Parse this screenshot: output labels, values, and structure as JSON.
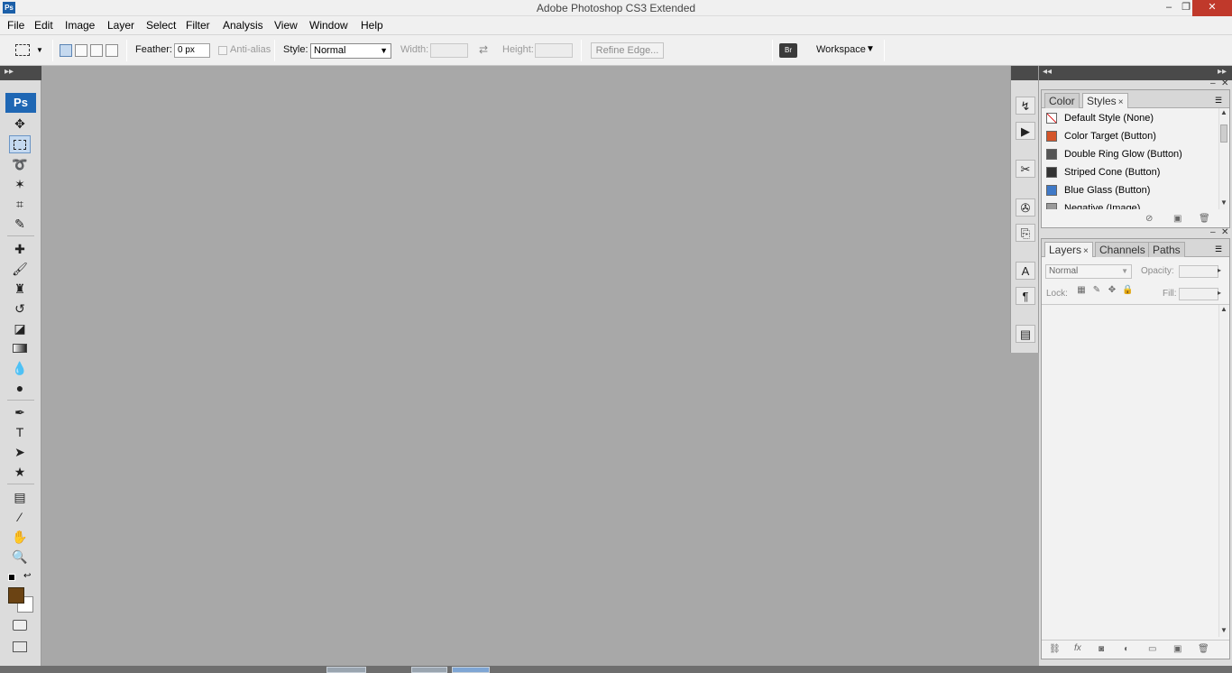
{
  "app": {
    "logo": "Ps",
    "title": "Adobe Photoshop CS3 Extended",
    "window_controls": {
      "minimize": "–",
      "restore": "❐",
      "close": "✕"
    }
  },
  "menubar": {
    "items": [
      "File",
      "Edit",
      "Image",
      "Layer",
      "Select",
      "Filter",
      "Analysis",
      "View",
      "Window",
      "Help"
    ]
  },
  "options": {
    "feather_label": "Feather:",
    "feather_value": "0 px",
    "antialias_label": "Anti-alias",
    "style_label": "Style:",
    "style_value": "Normal",
    "width_label": "Width:",
    "height_label": "Height:",
    "refine_edge": "Refine Edge...",
    "workspace_label": "Workspace",
    "workspace_arrow": "▼"
  },
  "toolbox": {
    "header": "▸▸",
    "badge": "Ps"
  },
  "styles_panel": {
    "tabs": [
      "Color",
      "Styles"
    ],
    "close_glyph": "×",
    "items": [
      {
        "name": "Default Style (None)",
        "color": "#ffffff"
      },
      {
        "name": "Color Target (Button)",
        "color": "#d4552a"
      },
      {
        "name": "Double Ring Glow (Button)",
        "color": "#555555"
      },
      {
        "name": "Striped Cone (Button)",
        "color": "#333333"
      },
      {
        "name": "Blue Glass (Button)",
        "color": "#3f79c7"
      },
      {
        "name": "Negative (Image)",
        "color": "#9a9a9a"
      }
    ]
  },
  "layers_panel": {
    "tabs": [
      "Layers",
      "Channels",
      "Paths"
    ],
    "close_glyph": "×",
    "blend_mode": "Normal",
    "opacity_label": "Opacity:",
    "lock_label": "Lock:",
    "fill_label": "Fill:"
  },
  "colors": {
    "foreground": "#6b4313",
    "background": "#ffffff",
    "workspace": "#a8a8a8",
    "accent": "#1f67b4"
  }
}
